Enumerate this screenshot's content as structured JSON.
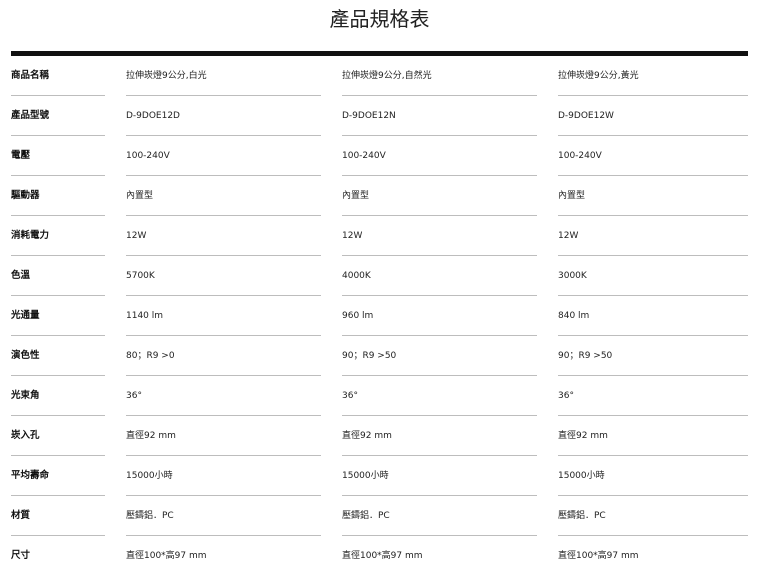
{
  "page": {
    "title": "產品規格表"
  },
  "table": {
    "rows": [
      {
        "label": "商品名稱",
        "values": [
          "拉伸崁燈9公分,白光",
          "拉伸崁燈9公分,自然光",
          "拉伸崁燈9公分,黃光"
        ]
      },
      {
        "label": "產品型號",
        "values": [
          "D-9DOE12D",
          "D-9DOE12N",
          "D-9DOE12W"
        ]
      },
      {
        "label": "電壓",
        "values": [
          "100-240V",
          "100-240V",
          "100-240V"
        ]
      },
      {
        "label": "驅動器",
        "values": [
          "內置型",
          "內置型",
          "內置型"
        ]
      },
      {
        "label": "消耗電力",
        "values": [
          "12W",
          "12W",
          "12W"
        ]
      },
      {
        "label": "色溫",
        "values": [
          "5700K",
          "4000K",
          "3000K"
        ]
      },
      {
        "label": "光通量",
        "values": [
          "1140 lm",
          "960 lm",
          "840 lm"
        ]
      },
      {
        "label": "演色性",
        "values": [
          "80；R9 >0",
          "90；R9 >50",
          "90；R9 >50"
        ]
      },
      {
        "label": "光束角",
        "values": [
          "36°",
          "36°",
          "36°"
        ]
      },
      {
        "label": "崁入孔",
        "values": [
          "直徑92 mm",
          "直徑92 mm",
          "直徑92 mm"
        ]
      },
      {
        "label": "平均壽命",
        "values": [
          "15000小時",
          "15000小時",
          "15000小時"
        ]
      },
      {
        "label": "材質",
        "values": [
          "壓鑄鋁．PC",
          "壓鑄鋁．PC",
          "壓鑄鋁．PC"
        ]
      },
      {
        "label": "尺寸",
        "values": [
          "直徑100*高97 mm",
          "直徑100*高97 mm",
          "直徑100*高97 mm"
        ]
      }
    ]
  }
}
